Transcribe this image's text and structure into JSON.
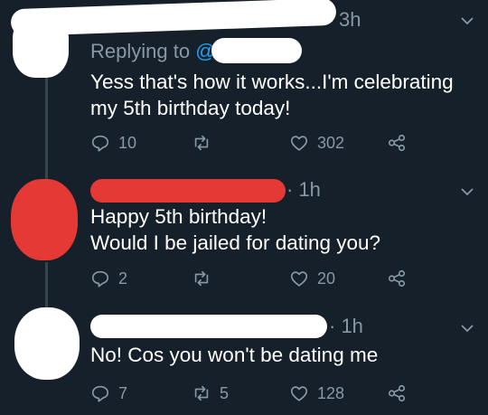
{
  "tweets": [
    {
      "time": "3h",
      "replying_label": "Replying to",
      "replying_handle": "@",
      "lines": [
        "Yess that's how it works...I'm celebrating",
        "my 5th birthday today!"
      ],
      "replies": "10",
      "retweets": "",
      "likes": "302"
    },
    {
      "time": "· 1h",
      "lines": [
        "Happy 5th birthday!",
        "Would I be jailed for dating you?"
      ],
      "replies": "2",
      "retweets": "",
      "likes": "20"
    },
    {
      "time": "· 1h",
      "lines": [
        "No! Cos you won't be dating me"
      ],
      "replies": "7",
      "retweets": "5",
      "likes": "128"
    }
  ],
  "colors": {
    "background": "#15202b",
    "muted": "#8899a6",
    "link": "#1da1f2",
    "redaction_red": "#e53935",
    "redaction_white": "#ffffff"
  },
  "icons": {
    "reply": "reply-icon",
    "retweet": "retweet-icon",
    "like": "heart-icon",
    "share": "share-icon",
    "menu": "chevron-down-icon"
  }
}
